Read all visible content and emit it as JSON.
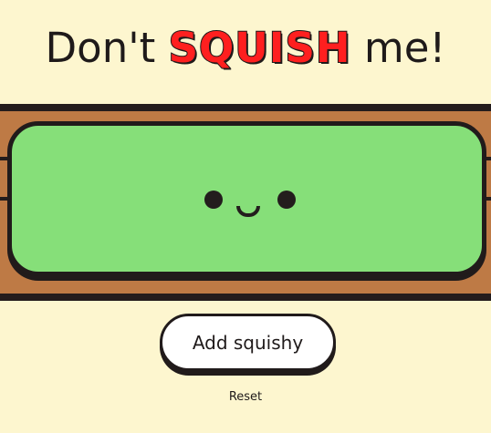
{
  "header": {
    "title_before": "Don't",
    "title_highlight": "SQUISH",
    "title_after": "me!"
  },
  "actions": {
    "add_label": "Add squishy",
    "reset_label": "Reset"
  },
  "colors": {
    "background": "#fdf6cf",
    "shelf": "#be7a45",
    "squishy": "#86df79",
    "highlight": "#ff1f1f",
    "outline": "#211b1b"
  }
}
